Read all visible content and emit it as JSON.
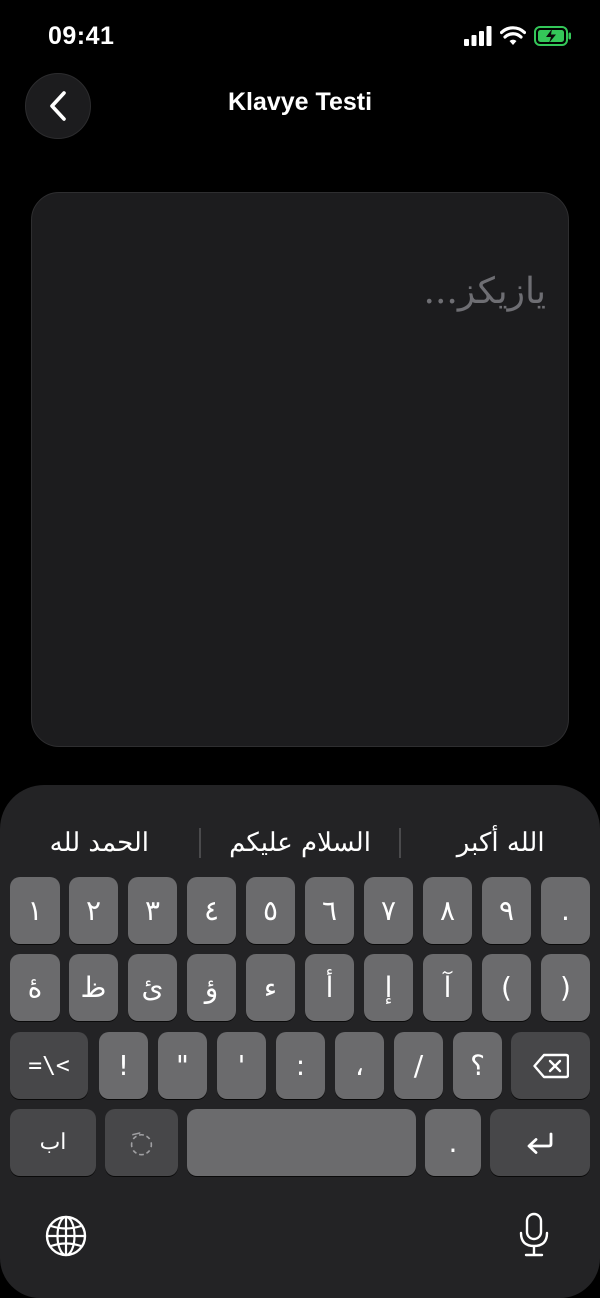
{
  "status": {
    "time": "09:41"
  },
  "nav": {
    "title": "Klavye Testi"
  },
  "editor": {
    "placeholder": "يازيكز..."
  },
  "suggestions": [
    "الحمد لله",
    "السلام عليكم",
    "الله أكبر"
  ],
  "rows": [
    [
      "١",
      "٢",
      "٣",
      "٤",
      "٥",
      "٦",
      "٧",
      "٨",
      "٩",
      "."
    ],
    [
      "ۀ",
      "ظ",
      "ئ",
      "ؤ",
      "ء",
      "أ",
      "إ",
      "آ",
      "(",
      ")"
    ],
    [
      "!",
      "\"",
      "'",
      ":",
      "،",
      "/",
      "؟"
    ]
  ],
  "special_keys": {
    "symbols_toggle": "=\\<",
    "alphabet_toggle": "اب",
    "diacritic": "◌َ",
    "period": "."
  },
  "icons": {
    "back": "chevron-left-icon",
    "backspace": "delete-icon",
    "return": "return-icon",
    "globe": "globe-icon",
    "mic": "microphone-icon"
  }
}
